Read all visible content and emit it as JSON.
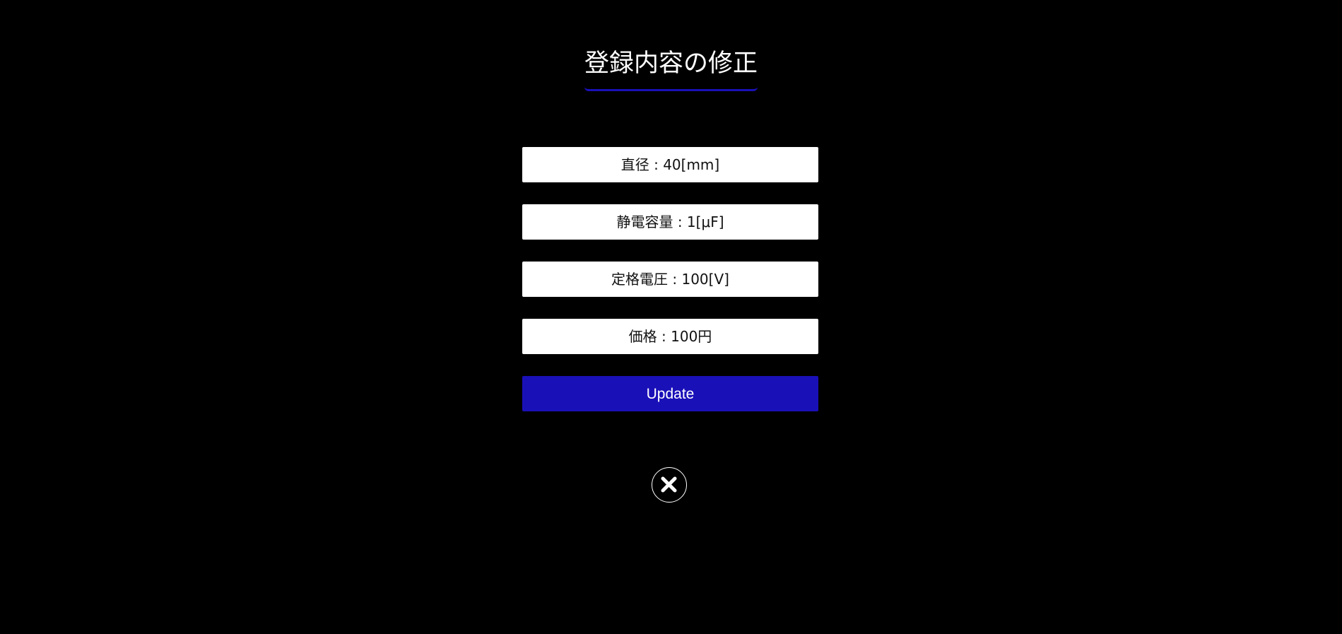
{
  "title": "登録内容の修正",
  "fields": [
    {
      "label": "直径 : 40[mm]"
    },
    {
      "label": "静電容量 : 1[μF]"
    },
    {
      "label": "定格電圧 : 100[V]"
    },
    {
      "label": "価格 : 100円"
    }
  ],
  "update_button": {
    "label": "Update"
  },
  "close_button": {
    "icon": "close-icon"
  },
  "colors": {
    "background": "#000000",
    "accent": "#1a10b8",
    "field_bg": "#ffffff"
  }
}
